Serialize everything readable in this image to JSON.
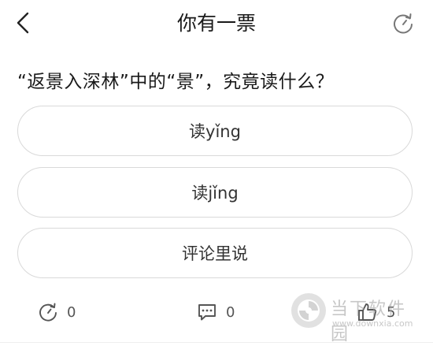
{
  "header": {
    "title": "你有一票"
  },
  "question": {
    "text": "“返景入深林”中的“景”，究竟读什么？"
  },
  "options": [
    {
      "label": "读yǐng"
    },
    {
      "label": "读jǐng"
    },
    {
      "label": "评论里说"
    }
  ],
  "footer": {
    "refresh_count": "0",
    "comment_count": "0",
    "like_count": "5"
  },
  "watermark": {
    "brand": "当下软件园",
    "url": "www.downxia.com"
  },
  "icons": {
    "back": "chevron-left-icon",
    "refresh": "refresh-icon",
    "comment": "comment-icon",
    "like": "thumbs-up-icon"
  }
}
